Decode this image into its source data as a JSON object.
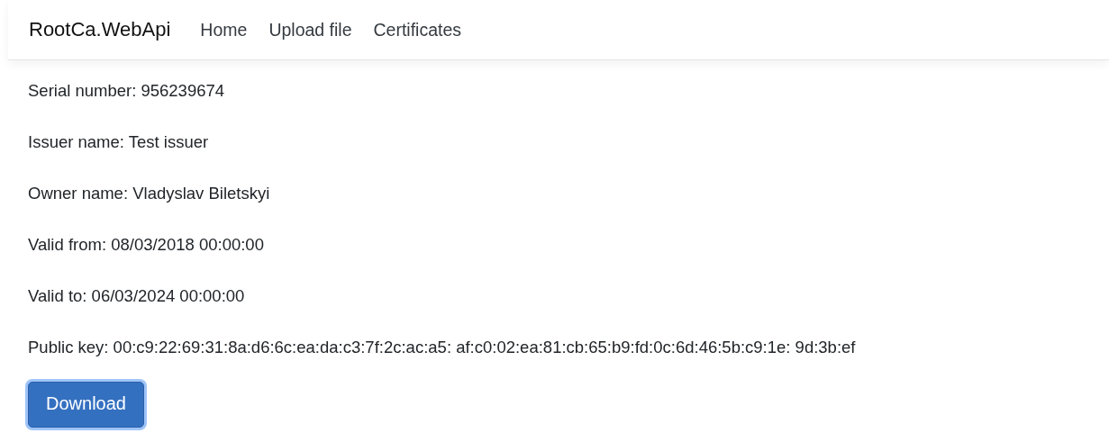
{
  "navbar": {
    "brand": "RootCa.WebApi",
    "links": [
      "Home",
      "Upload file",
      "Certificates"
    ]
  },
  "fields": [
    "Serial number: 956239674",
    "Issuer name: Test issuer",
    "Owner name: Vladyslav Biletskyi",
    "Valid from: 08/03/2018 00:00:00",
    "Valid to: 06/03/2024 00:00:00",
    "Public key: 00:c9:22:69:31:8a:d6:6c:ea:da:c3:7f:2c:ac:a5: af:c0:02:ea:81:cb:65:b9:fd:0c:6d:46:5b:c9:1e: 9d:3b:ef"
  ],
  "download_button": {
    "label": "Download",
    "focused": true
  }
}
